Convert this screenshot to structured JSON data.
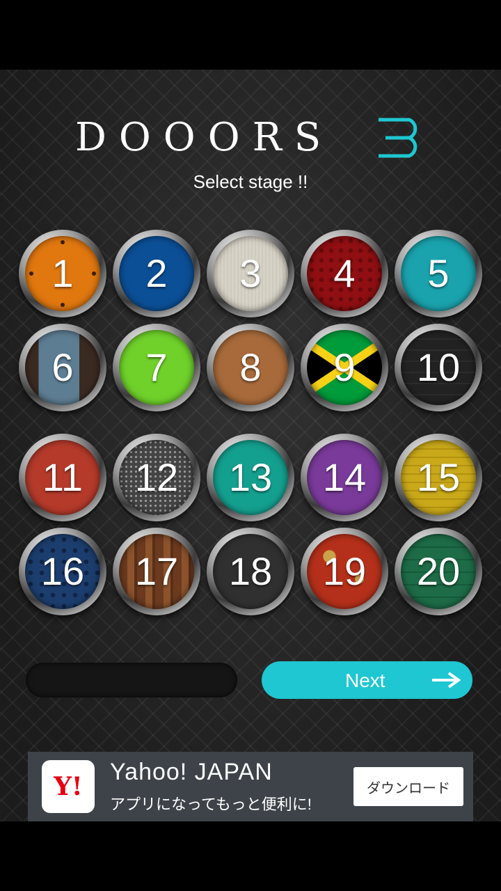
{
  "header": {
    "title": "DOOORS",
    "subtitle": "Select stage !!",
    "accent_color": "#1ec7d1"
  },
  "stages": [
    {
      "number": "1",
      "color": "#e0770f",
      "pattern": "riveted-door"
    },
    {
      "number": "2",
      "color": "#0b4f96",
      "pattern": "plain"
    },
    {
      "number": "3",
      "color": "#d7d2c6",
      "pattern": "fabric"
    },
    {
      "number": "4",
      "color": "#8f0f12",
      "pattern": "damask"
    },
    {
      "number": "5",
      "color": "#1aa3ad",
      "pattern": "plain"
    },
    {
      "number": "6",
      "color": "#5d7d92",
      "pattern": "door"
    },
    {
      "number": "7",
      "color": "#6fd12a",
      "pattern": "plain"
    },
    {
      "number": "8",
      "color": "#a86a3a",
      "pattern": "plain"
    },
    {
      "number": "9",
      "color": "#f7d116",
      "pattern": "jamaica-flag"
    },
    {
      "number": "10",
      "color": "#222222",
      "pattern": "stripes"
    },
    {
      "number": "11",
      "color": "#b53a2a",
      "pattern": "plain"
    },
    {
      "number": "12",
      "color": "#444444",
      "pattern": "mesh"
    },
    {
      "number": "13",
      "color": "#14a08f",
      "pattern": "plain"
    },
    {
      "number": "14",
      "color": "#7a3a9a",
      "pattern": "plain"
    },
    {
      "number": "15",
      "color": "#c9a91a",
      "pattern": "stripes"
    },
    {
      "number": "16",
      "color": "#1c3e6e",
      "pattern": "fleur"
    },
    {
      "number": "17",
      "color": "#7a4522",
      "pattern": "planks"
    },
    {
      "number": "18",
      "color": "#303030",
      "pattern": "plain"
    },
    {
      "number": "19",
      "color": "#b5301a",
      "pattern": "rust"
    },
    {
      "number": "20",
      "color": "#1d6b47",
      "pattern": "stripes"
    }
  ],
  "navigation": {
    "next_label": "Next",
    "next_icon": "arrow-right-icon"
  },
  "ad": {
    "logo_text": "Y!",
    "title": "Yahoo! JAPAN",
    "subtitle": "アプリになってもっと便利に!",
    "button_label": "ダウンロード"
  }
}
